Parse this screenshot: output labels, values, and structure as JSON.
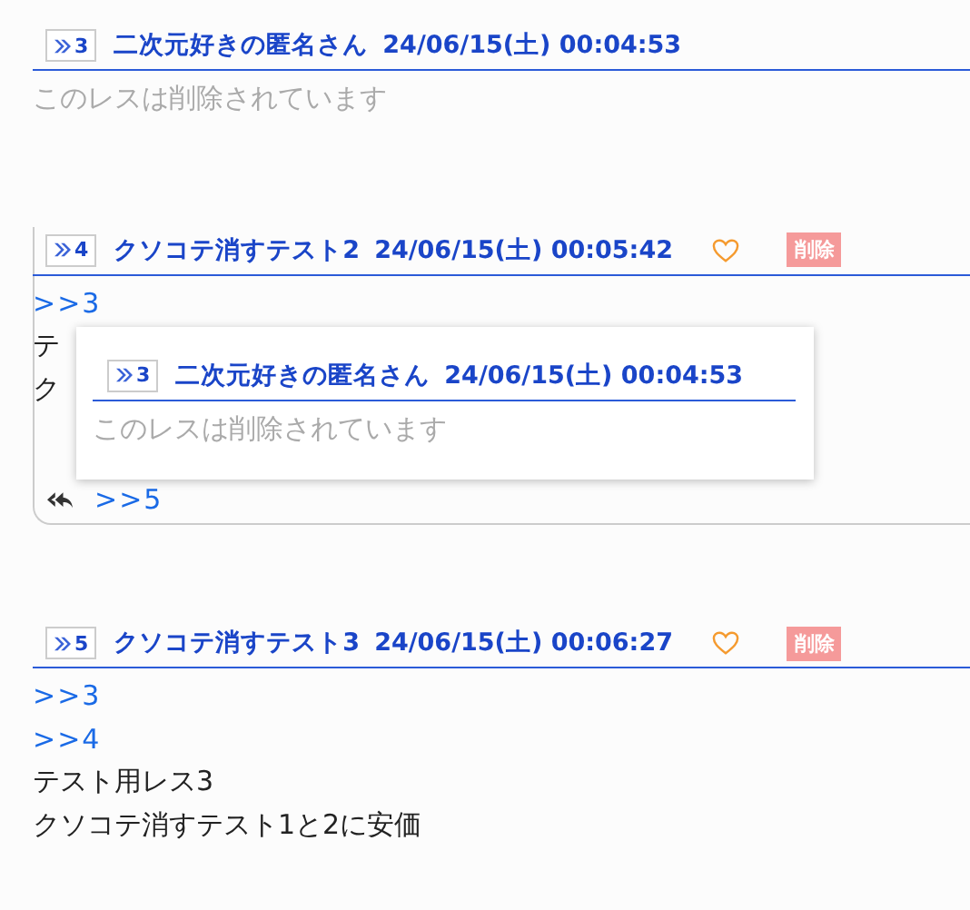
{
  "posts": [
    {
      "number": "3",
      "name": "二次元好きの匿名さん",
      "date": "24/06/15(土) 00:04:53",
      "body": [
        {
          "kind": "deleted",
          "text": "このレスは削除されています"
        }
      ]
    },
    {
      "number": "4",
      "name": "クソコテ消すテスト2",
      "date": "24/06/15(土) 00:05:42",
      "liked": false,
      "delete_label": "削除",
      "body": [
        {
          "kind": "anchor",
          "text": ">>3"
        },
        {
          "kind": "text",
          "text": "テ"
        },
        {
          "kind": "text",
          "text": "ク"
        }
      ],
      "replies": [
        ">>5"
      ],
      "popup": {
        "number": "3",
        "name": "二次元好きの匿名さん",
        "date": "24/06/15(土) 00:04:53",
        "body": [
          {
            "kind": "deleted",
            "text": "このレスは削除されています"
          }
        ]
      }
    },
    {
      "number": "5",
      "name": "クソコテ消すテスト3",
      "date": "24/06/15(土) 00:06:27",
      "liked": false,
      "delete_label": "削除",
      "body": [
        {
          "kind": "anchor",
          "text": ">>3"
        },
        {
          "kind": "anchor",
          "text": ">>4"
        },
        {
          "kind": "text",
          "text": "テスト用レス3"
        },
        {
          "kind": "text",
          "text": "クソコテ消すテスト1と2に安価"
        }
      ]
    }
  ]
}
